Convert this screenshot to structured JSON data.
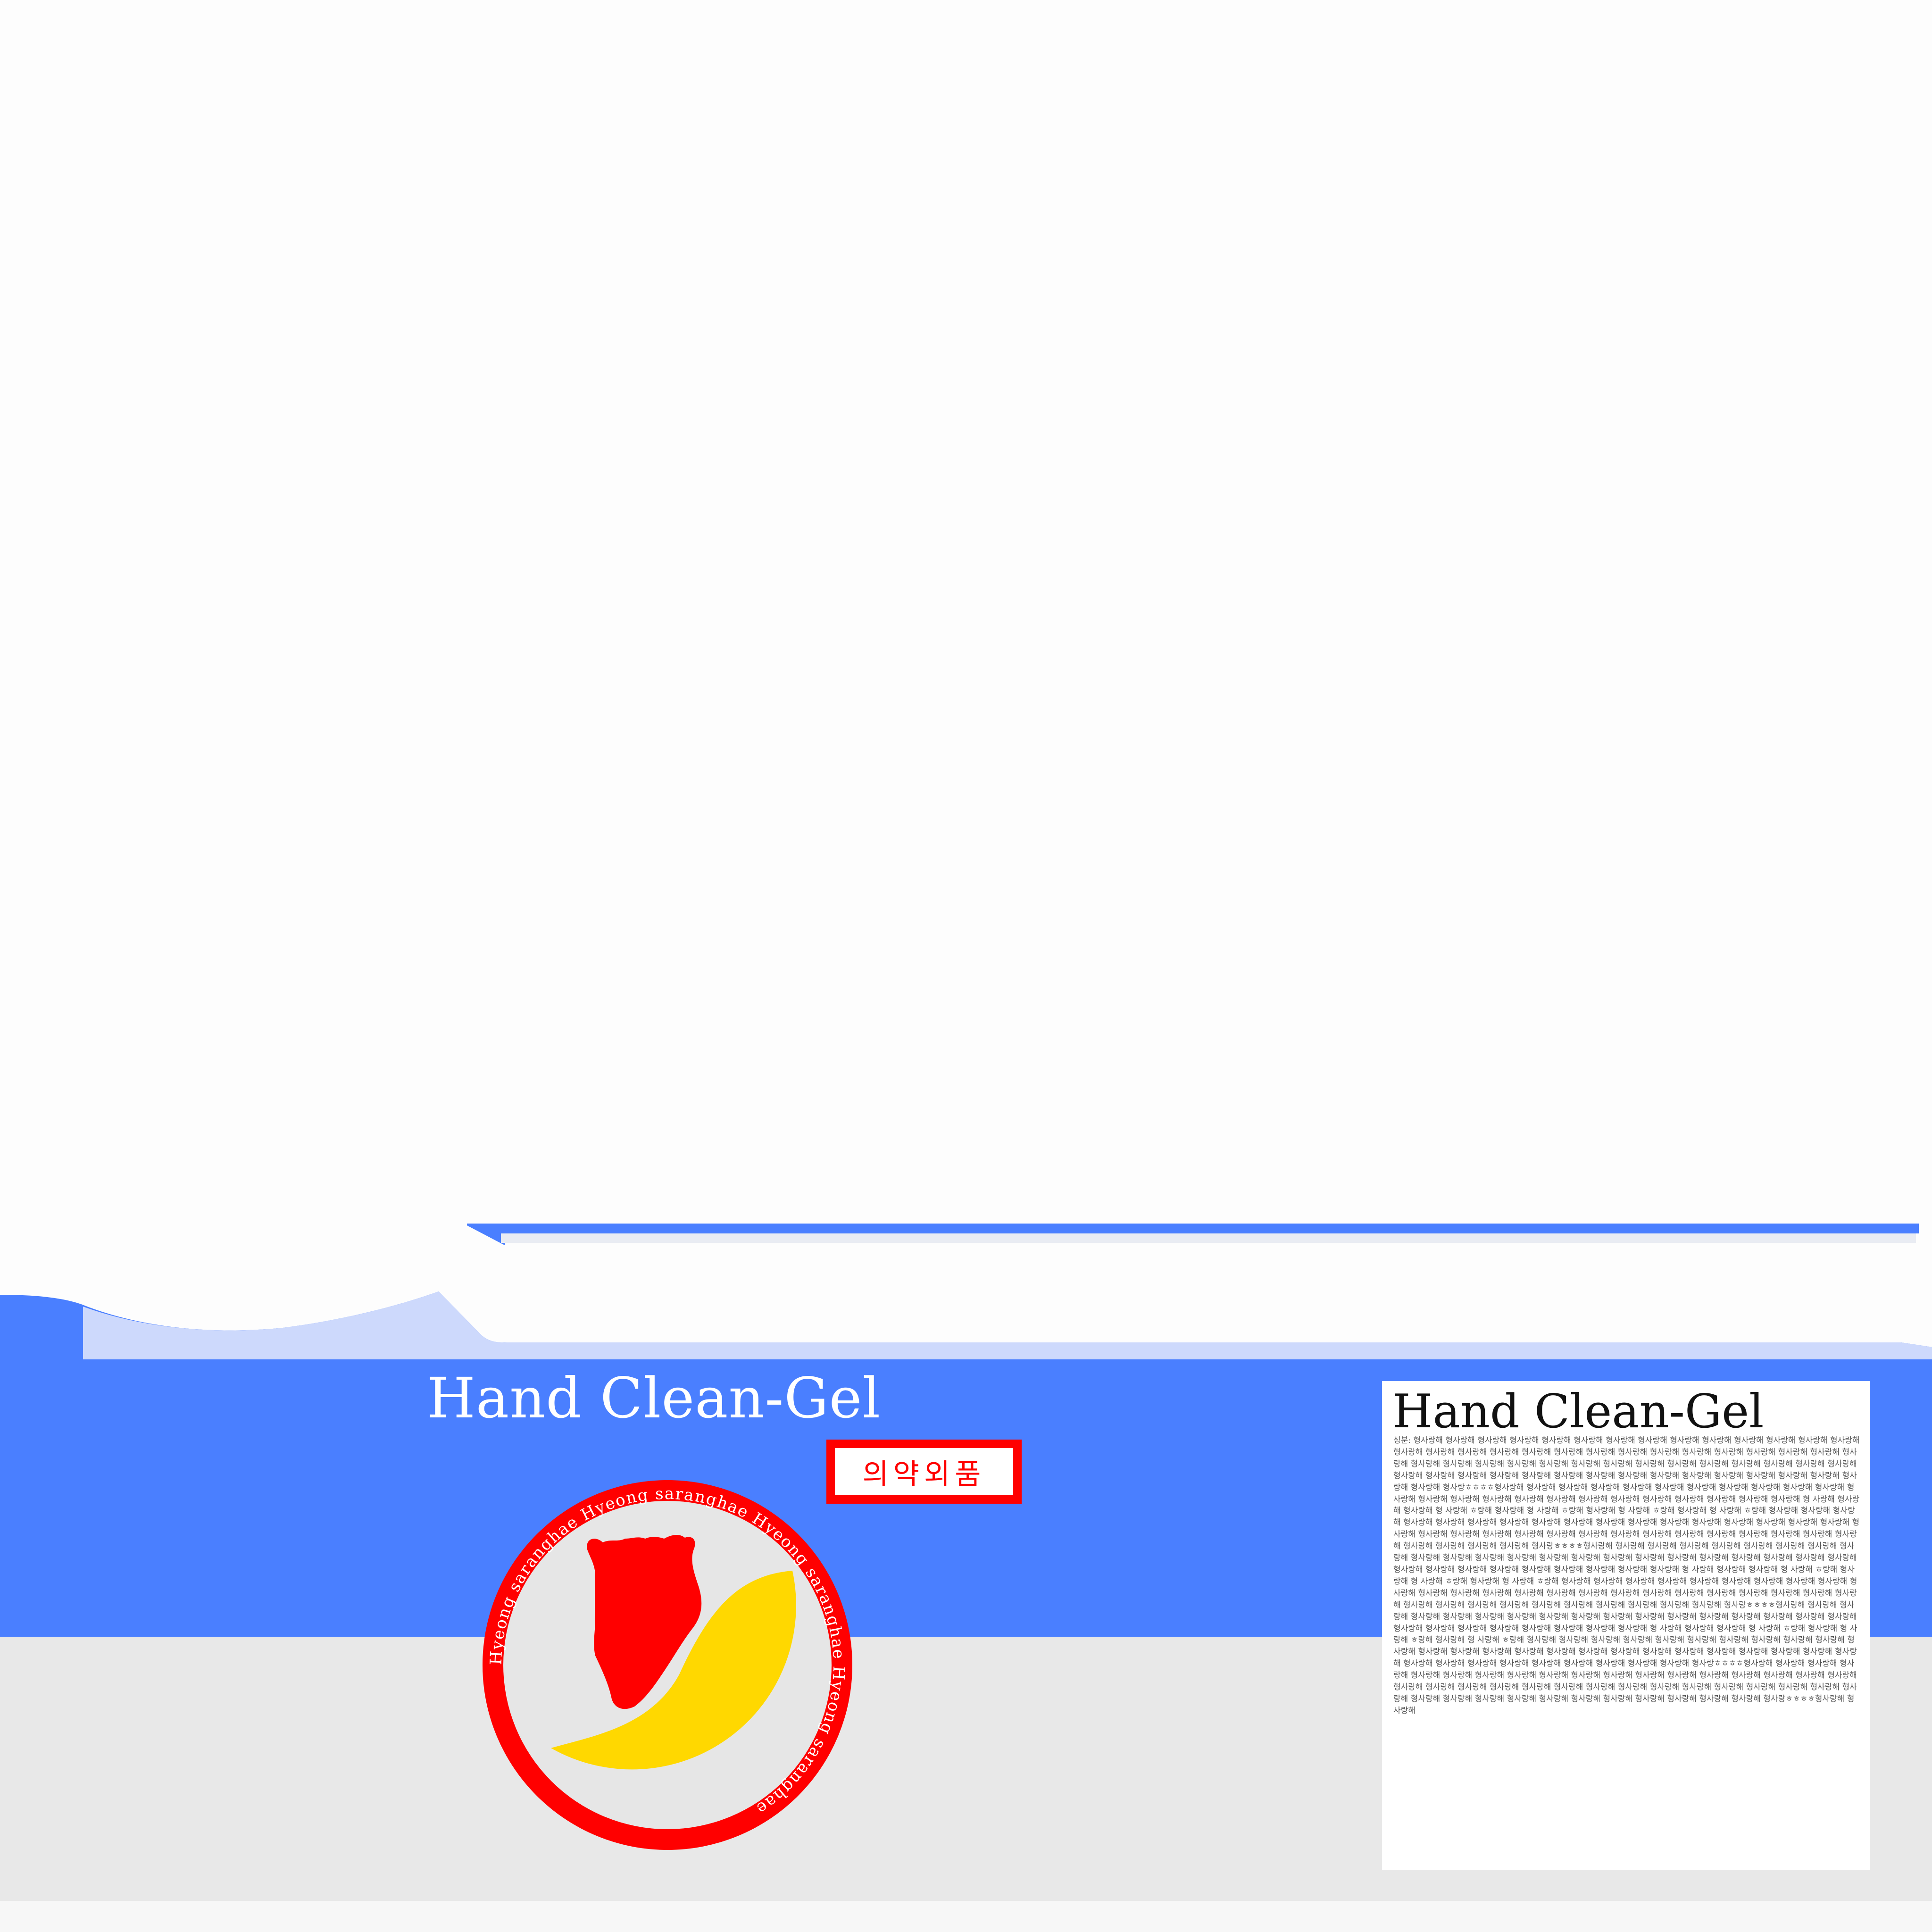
{
  "product": {
    "name": "Hand Clean-Gel",
    "category_badge": "의약외품",
    "seal_ring_text": "Hyeong saranghae Hyeong saranghae Hyeong saranghae Hyeong saranghae",
    "seal_icon": "horse-head-silhouette-icon"
  },
  "info_panel": {
    "title": "Hand Clean-Gel",
    "body": "성분: 형사랑해 형사랑해 형사랑해 형사랑해 형사랑해 형사랑해 형사랑해 형사랑해 형사랑해 형사랑해 형사랑해 형사랑해 형사랑해 형사랑해 형사랑해 형사랑해 형사랑해 형사랑해 형사랑해 형사랑해 형사랑해 형사랑해 형사랑해 형사랑해 형사랑해 형사랑해 형사랑해 형사랑해 형사랑해 형사랑해 형사랑해 형사랑해 형사랑해 형사랑해 형사랑해 형사랑해 형사랑해 형사랑해 형사랑해 형사랑해 형사랑해 형사랑해 형사랑해 형사랑해 형사랑해 형사랑해 형사랑해 형사랑해 형사랑해 형사랑해 형사랑해 형사랑해 형사랑해 형사랑해 형사랑해 형사랑해 형사랑해 형사랑해 형사랑해 형사랑ㅎㅎㅎㅎ형사랑해 형사랑해 형사랑해 형사랑해 형사랑해 형사랑해 형사랑해 형사랑해 형사랑해 형사랑해 형사랑해 형사랑해 형사랑해 형사랑해 형사랑해 형사랑해 형사랑해 형사랑해 형사랑해 형사랑해 형사랑해 형사랑해 형사랑해 형사랑해 형 사랑해 형사랑해 형사랑해 형 사랑해 ㅎ랑해 형사랑해 형 사랑해 ㅎ랑해 형사랑해 형 사랑해 ㅎ랑해 형사랑해 형 사랑해 ㅎ랑해 형사랑해 형사랑해 형사랑해 형사랑해 형사랑해 형사랑해 형사랑해 형사랑해 형사랑해 형사랑해 형사랑해 형사랑해 형사랑해 형사랑해 형사랑해 형사랑해 형사랑해 형사랑해 형사랑해 형사랑해 형사랑해 형사랑해 형사랑해 형사랑해 형사랑해 형사랑해 형사랑해 형사랑해 형사랑해 형사랑해 형사랑해 형사랑해 형사랑해 형사랑해 형사랑해 형사랑해 형사랑ㅎㅎㅎㅎ형사랑해 형사랑해 형사랑해 형사랑해 형사랑해 형사랑해 형사랑해 형사랑해 형사랑해 형사랑해 형사랑해 형사랑해 형사랑해 형사랑해 형사랑해 형사랑해 형사랑해 형사랑해 형사랑해 형사랑해 형사랑해 형사랑해 형사랑해 형사랑해 형사랑해 형사랑해 형사랑해 형사랑해 형사랑해 형사랑해 형사랑해 형사랑해 형 사랑해 형사랑해 형사랑해 형 사랑해 ㅎ랑해 형사랑해 형 사랑해 ㅎ랑해 형사랑해 형 사랑해 ㅎ랑해 형사랑해 형사랑해 형사랑해 형사랑해 형사랑해 형사랑해 형사랑해 형사랑해 형사랑해 형사랑해 형사랑해 형사랑해 형사랑해 형사랑해 형사랑해 형사랑해 형사랑해 형사랑해 형사랑해 형사랑해 형사랑해 형사랑해 형사랑해 형사랑해 형사랑해 형사랑해 형사랑해 형사랑해 형사랑해 형사랑해 형사랑해 형사랑해 형사랑해 형사랑해 형사랑ㅎㅎㅎㅎ형사랑해 형사랑해 형사랑해 형사랑해 형사랑해 형사랑해 형사랑해 형사랑해 형사랑해 형사랑해 형사랑해 형사랑해 형사랑해 형사랑해 형사랑해 형사랑해 형사랑해 형사랑해 형사랑해 형사랑해 형사랑해 형사랑해 형사랑해 형사랑해 형사랑해 형 사랑해 형사랑해 형사랑해 형 사랑해 ㅎ랑해 형사랑해 형 사랑해 ㅎ랑해 형사랑해 형 사랑해 ㅎ랑해 형사랑해 형사랑해 형사랑해 형사랑해 형사랑해 형사랑해 형사랑해 형사랑해 형사랑해 형사랑해 형사랑해 형사랑해 형사랑해 형사랑해 형사랑해 형사랑해 형사랑해 형사랑해 형사랑해 형사랑해 형사랑해 형사랑해 형사랑해 형사랑해 형사랑해 형사랑해 형사랑해 형사랑해 형사랑해 형사랑해 형사랑해 형사랑해 형사랑해 형사랑해 형사랑ㅎㅎㅎㅎ형사랑해 형사랑해 형사랑해 형사랑해 형사랑해 형사랑해 형사랑해 형사랑해 형사랑해 형사랑해 형사랑해 형사랑해 형사랑해 형사랑해 형사랑해 형사랑해 형사랑해 형사랑해 형사랑해 형사랑해 형사랑해 형사랑해 형사랑해 형사랑해 형사랑해 형사랑해 형사랑해 형사랑해 형사랑해 형사랑해 형사랑해 형사랑해 형사랑해 형사랑해 형사랑해 형사랑해 형사랑해 형사랑해 형사랑해 형사랑해 형사랑해 형사랑해 형사랑해 형사랑해 형사랑ㅎㅎㅎㅎ형사랑해 형사랑해"
  },
  "colors": {
    "brand_blue": "#4a7fff",
    "light_blue": "#cdd9fc",
    "seal_red": "#ff0000",
    "accent_yellow": "#ffd800",
    "panel_gray": "#e8e8e8",
    "seal_inner_gray": "#e6e6e6"
  }
}
